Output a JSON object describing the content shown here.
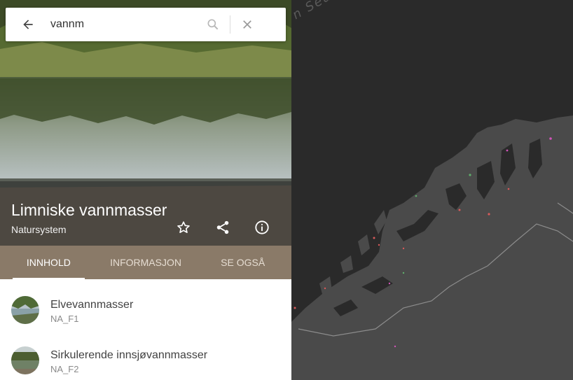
{
  "search": {
    "value": "vannm",
    "placeholder": ""
  },
  "hero": {
    "title": "Limniske vannmasser",
    "subtitle": "Natursystem"
  },
  "tabs": [
    {
      "label": "INNHOLD",
      "active": true
    },
    {
      "label": "INFORMASJON",
      "active": false
    },
    {
      "label": "SE OGSÅ",
      "active": false
    }
  ],
  "items": [
    {
      "title": "Elvevannmasser",
      "code": "NA_F1"
    },
    {
      "title": "Sirkulerende innsjøvannmasser",
      "code": "NA_F2"
    }
  ],
  "map": {
    "sea_label": "n Sea"
  },
  "colors": {
    "tab_bar": "#8a7a68",
    "map_bg": "#2a2a2a",
    "land": "#4a4a4a"
  },
  "icons": [
    "arrow-back-icon",
    "search-icon",
    "close-icon",
    "star-outline-icon",
    "share-icon",
    "info-icon"
  ]
}
